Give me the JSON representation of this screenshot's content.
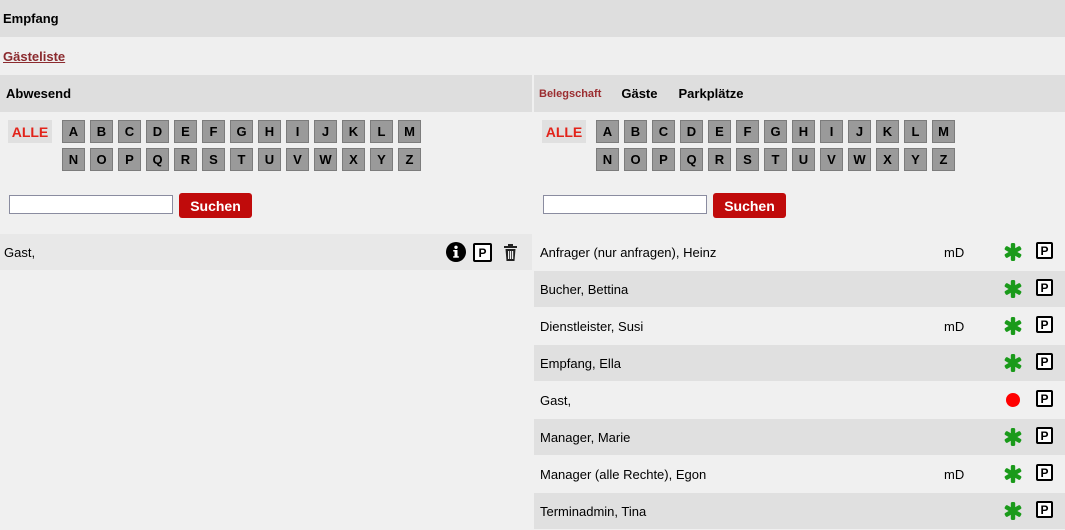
{
  "header": {
    "title": "Empfang"
  },
  "nav": {
    "guest_list_link": "Gästeliste"
  },
  "left": {
    "title": "Abwesend",
    "alle_label": "ALLE",
    "letters": [
      "A",
      "B",
      "C",
      "D",
      "E",
      "F",
      "G",
      "H",
      "I",
      "J",
      "K",
      "L",
      "M",
      "N",
      "O",
      "P",
      "Q",
      "R",
      "S",
      "T",
      "U",
      "V",
      "W",
      "X",
      "Y",
      "Z"
    ],
    "search": {
      "value": "",
      "placeholder": "",
      "button_label": "Suchen"
    },
    "rows": [
      {
        "name": "Gast,",
        "icons": [
          "info-icon",
          "parking-icon",
          "trash-icon"
        ],
        "parking_label": "P"
      }
    ]
  },
  "right": {
    "tabs": [
      {
        "label": "Belegschaft",
        "active": true
      },
      {
        "label": "Gäste",
        "active": false
      },
      {
        "label": "Parkplätze",
        "active": false
      }
    ],
    "alle_label": "ALLE",
    "letters": [
      "A",
      "B",
      "C",
      "D",
      "E",
      "F",
      "G",
      "H",
      "I",
      "J",
      "K",
      "L",
      "M",
      "N",
      "O",
      "P",
      "Q",
      "R",
      "S",
      "T",
      "U",
      "V",
      "W",
      "X",
      "Y",
      "Z"
    ],
    "search": {
      "value": "",
      "placeholder": "",
      "button_label": "Suchen"
    },
    "rows": [
      {
        "name": "Anfrager (nur anfragen), Heinz",
        "md": "mD",
        "status": "green-asterisk-icon",
        "parking_label": "P"
      },
      {
        "name": "Bucher, Bettina",
        "md": "",
        "status": "green-asterisk-icon",
        "parking_label": "P"
      },
      {
        "name": "Dienstleister, Susi",
        "md": "mD",
        "status": "green-asterisk-icon",
        "parking_label": "P"
      },
      {
        "name": "Empfang, Ella",
        "md": "",
        "status": "green-asterisk-icon",
        "parking_label": "P"
      },
      {
        "name": "Gast,",
        "md": "",
        "status": "red-dot-icon",
        "parking_label": "P"
      },
      {
        "name": "Manager, Marie",
        "md": "",
        "status": "green-asterisk-icon",
        "parking_label": "P"
      },
      {
        "name": "Manager (alle Rechte), Egon",
        "md": "mD",
        "status": "green-asterisk-icon",
        "parking_label": "P"
      },
      {
        "name": "Terminadmin, Tina",
        "md": "",
        "status": "green-asterisk-icon",
        "parking_label": "P"
      }
    ]
  },
  "colors": {
    "header_bg": "#dedede",
    "link": "#8b2a2e",
    "alle_text": "#e2231a",
    "letter_bg": "#9a9a9a",
    "button_bg": "#c00b0b",
    "status_green": "#1a9a1a",
    "status_red": "#ff0000"
  }
}
